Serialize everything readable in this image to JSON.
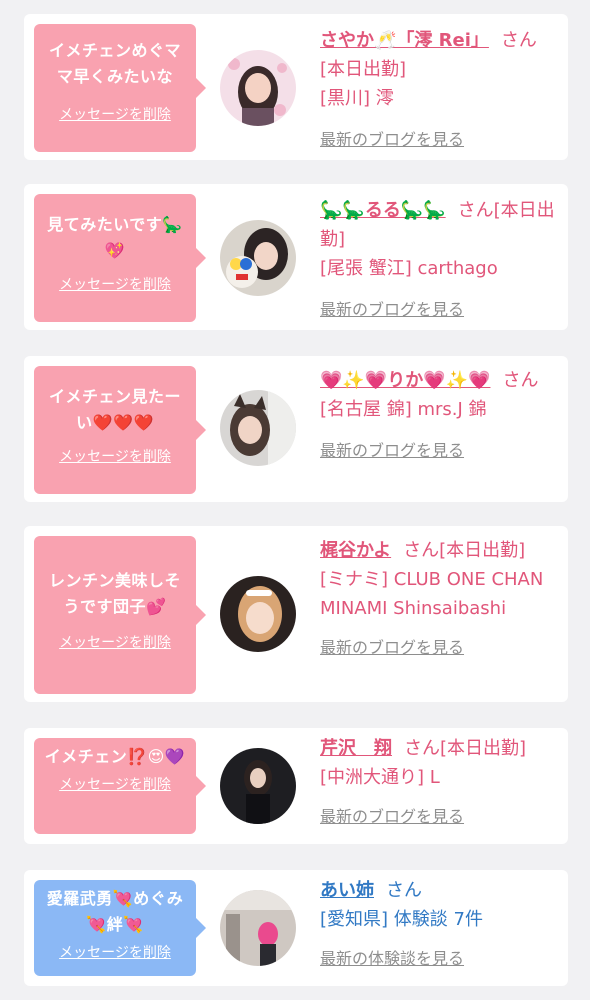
{
  "messages": [
    {
      "bubble": "イメチェンめぐママ早くみたいな",
      "delete_label": "メッセージを削除",
      "name": "さやか🥂「澪 Rei」",
      "suffix": "さん[本日出勤]",
      "store": "[黒川] 澪",
      "blog_label": "最新のブログを見る",
      "bubble_color": "#f9a2b0"
    },
    {
      "bubble": "見てみたいです🦕💖",
      "delete_label": "メッセージを削除",
      "name": "🦕🦕るる🦕🦕",
      "suffix": "さん[本日出勤]",
      "store": "[尾張 蟹江] carthago",
      "blog_label": "最新のブログを見る",
      "bubble_color": "#f9a2b0"
    },
    {
      "bubble": "イメチェン見たーい❤️❤️❤️",
      "delete_label": "メッセージを削除",
      "name": "💗✨💗りか💗✨💗",
      "suffix": "さん",
      "store": "[名古屋 錦] mrs.J 錦",
      "blog_label": "最新のブログを見る",
      "bubble_color": "#f9a2b0"
    },
    {
      "bubble": "レンチン美味しそうです団子💕",
      "delete_label": "メッセージを削除",
      "name": "梶谷かよ",
      "suffix": "さん[本日出勤]",
      "store": "[ミナミ] CLUB ONE CHAN MINAMI Shinsaibashi",
      "blog_label": "最新のブログを見る",
      "bubble_color": "#f9a2b0"
    },
    {
      "bubble": "イメチェン⁉️😍💜",
      "delete_label": "メッセージを削除",
      "name": "芹沢　翔",
      "suffix": "さん[本日出勤]",
      "store": "[中洲大通り] L",
      "blog_label": "最新のブログを見る",
      "bubble_color": "#f9a2b0"
    },
    {
      "bubble": "愛羅武勇💘めぐみ💘絆💘",
      "delete_label": "メッセージを削除",
      "name": "あい姉",
      "suffix": "さん",
      "store": "[愛知県] 体験談 7件",
      "blog_label": "最新の体験談を見る",
      "bubble_color": "#8bb8f5"
    }
  ]
}
